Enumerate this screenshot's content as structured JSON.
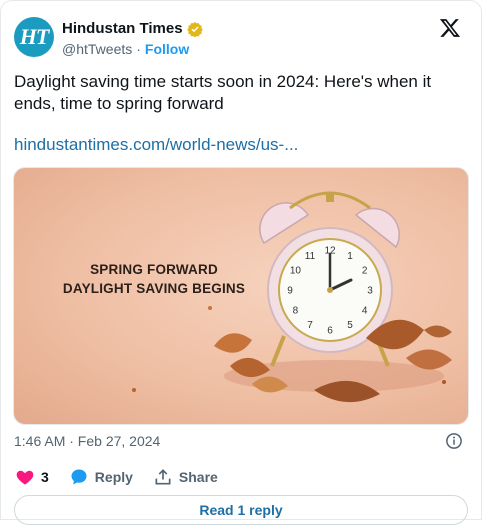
{
  "author": {
    "avatar_text": "HT",
    "name": "Hindustan Times",
    "handle": "@htTweets",
    "separator": "·",
    "follow_label": "Follow"
  },
  "tweet": {
    "text": "Daylight saving time starts soon in 2024: Here's when it ends, time to spring forward",
    "link": "hindustantimes.com/world-news/us-...",
    "timestamp": "1:46 AM · Feb 27, 2024"
  },
  "media": {
    "caption_line1": "SPRING FORWARD",
    "caption_line2": "DAYLIGHT SAVING BEGINS",
    "clock_numbers": [
      "12",
      "1",
      "2",
      "3",
      "4",
      "5",
      "6",
      "7",
      "8",
      "9",
      "10",
      "11"
    ]
  },
  "actions": {
    "like_count": "3",
    "reply_label": "Reply",
    "share_label": "Share"
  },
  "read_reply_label": "Read 1 reply",
  "icons": {
    "verified": "verified-badge-icon",
    "x_logo": "x-logo-icon",
    "info": "info-icon",
    "heart": "heart-icon",
    "reply": "reply-bubble-icon",
    "share": "share-icon"
  },
  "colors": {
    "link": "#1d6fa5",
    "follow": "#1d9bf0",
    "like": "#f91880",
    "verified": "#e2b719",
    "avatar_bg": "#1a9bbf"
  }
}
